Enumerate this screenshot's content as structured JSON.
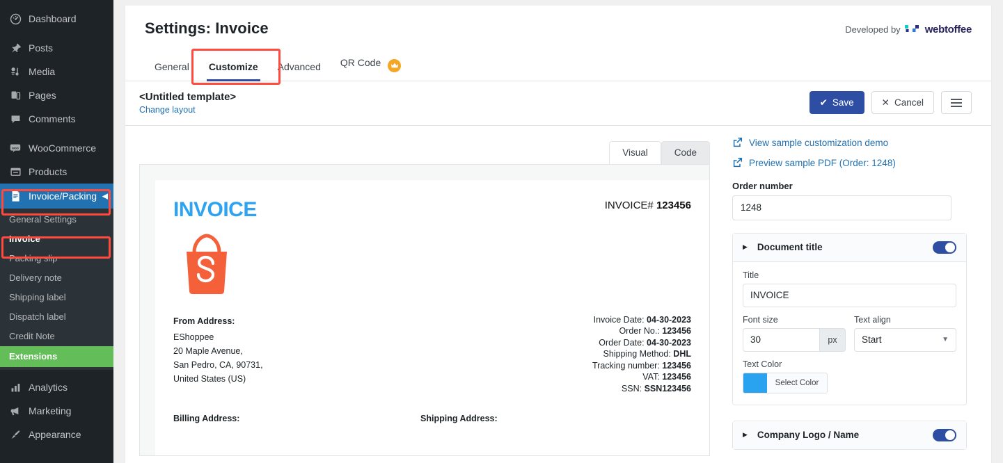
{
  "sidebar": {
    "items": [
      {
        "label": "Dashboard",
        "icon": "dashboard-icon"
      },
      {
        "label": "Posts",
        "icon": "pin-icon"
      },
      {
        "label": "Media",
        "icon": "media-icon"
      },
      {
        "label": "Pages",
        "icon": "pages-icon"
      },
      {
        "label": "Comments",
        "icon": "comments-icon"
      },
      {
        "label": "WooCommerce",
        "icon": "woocommerce-icon"
      },
      {
        "label": "Products",
        "icon": "products-icon"
      },
      {
        "label": "Invoice/Packing",
        "icon": "document-icon",
        "current": true
      },
      {
        "label": "Analytics",
        "icon": "analytics-icon"
      },
      {
        "label": "Marketing",
        "icon": "megaphone-icon"
      },
      {
        "label": "Appearance",
        "icon": "brush-icon"
      }
    ],
    "submenu": [
      {
        "label": "General Settings"
      },
      {
        "label": "Invoice",
        "active": true
      },
      {
        "label": "Packing slip"
      },
      {
        "label": "Delivery note"
      },
      {
        "label": "Shipping label"
      },
      {
        "label": "Dispatch label"
      },
      {
        "label": "Credit Note"
      }
    ],
    "extensions_label": "Extensions"
  },
  "header": {
    "title": "Settings: Invoice",
    "developed_by": "Developed by",
    "brand": "webtoffee"
  },
  "tabs": [
    {
      "label": "General",
      "active": false
    },
    {
      "label": "Customize",
      "active": true
    },
    {
      "label": "Advanced",
      "active": false
    },
    {
      "label": "QR Code",
      "active": false,
      "badge": "crown-icon"
    }
  ],
  "template_bar": {
    "name": "<Untitled template>",
    "change_layout": "Change layout",
    "save_label": "Save",
    "cancel_label": "Cancel"
  },
  "editor_tabs": [
    {
      "label": "Visual",
      "active": true
    },
    {
      "label": "Code",
      "active": false
    }
  ],
  "preview": {
    "title": "INVOICE",
    "invoice_no_label": "INVOICE#",
    "invoice_no": "123456",
    "from_heading": "From Address:",
    "from_lines": [
      "EShoppee",
      "20 Maple Avenue,",
      "San Pedro, CA, 90731,",
      "United States (US)"
    ],
    "meta": [
      {
        "label": "Invoice Date:",
        "value": "04-30-2023"
      },
      {
        "label": "Order No.:",
        "value": "123456"
      },
      {
        "label": "Order Date:",
        "value": "04-30-2023"
      },
      {
        "label": "Shipping Method:",
        "value": "DHL"
      },
      {
        "label": "Tracking number:",
        "value": "123456"
      },
      {
        "label": "VAT:",
        "value": "123456"
      },
      {
        "label": "SSN:",
        "value": "SSN123456"
      }
    ],
    "billing_heading": "Billing Address:",
    "shipping_heading": "Shipping Address:"
  },
  "panel_right": {
    "link_demo": "View sample customization demo",
    "link_preview": "Preview sample PDF (Order: 1248)",
    "order_number_label": "Order number",
    "order_number_value": "1248",
    "document_title_panel": {
      "heading": "Document title",
      "title_label": "Title",
      "title_value": "INVOICE",
      "font_size_label": "Font size",
      "font_size_value": "30",
      "font_size_unit": "px",
      "text_align_label": "Text align",
      "text_align_value": "Start",
      "text_color_label": "Text Color",
      "select_color_label": "Select Color",
      "color_value": "#29a3f0"
    },
    "company_panel": {
      "heading": "Company Logo / Name"
    }
  },
  "colors": {
    "accent_blue": "#2271b1",
    "save_blue": "#2d4ea2",
    "invoice_blue": "#2ea3f2",
    "logo_orange": "#f4603a",
    "extensions_green": "#63bd58",
    "annotation_red": "#ff4a3d"
  }
}
